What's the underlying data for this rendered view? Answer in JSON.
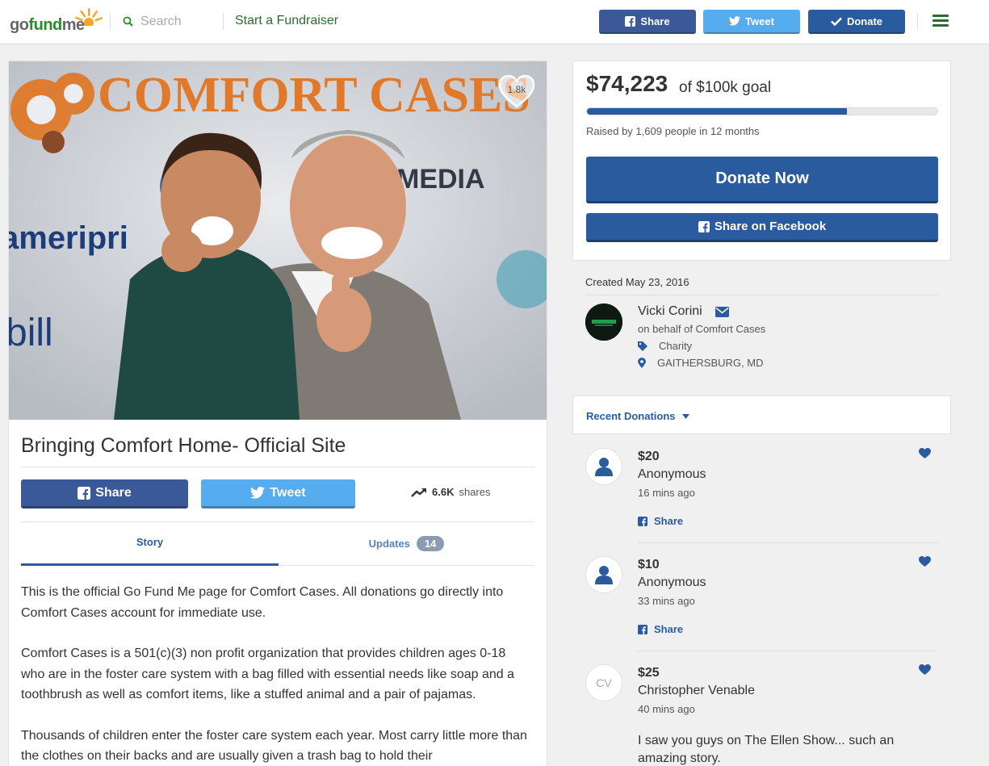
{
  "header": {
    "logo_parts": [
      "go",
      "fund",
      "me"
    ],
    "search_placeholder": "Search",
    "start_link": "Start a Fundraiser",
    "share_label": "Share",
    "tweet_label": "Tweet",
    "donate_label": "Donate"
  },
  "campaign": {
    "heart_count": "1.8k",
    "title": "Bringing Comfort Home- Official Site",
    "share_label": "Share",
    "tweet_label": "Tweet",
    "shares_count": "6.6K",
    "shares_word": "shares",
    "tabs": {
      "story": "Story",
      "updates": "Updates",
      "updates_count": "14"
    },
    "story_paragraphs": [
      "This is the official Go Fund Me page for Comfort Cases. All donations go directly into Comfort Cases account for immediate use.",
      "Comfort Cases is a 501(c)(3) non profit organization that provides children ages 0-18 who are in the foster care system with a bag filled with essential needs like soap and a toothbrush as well as comfort items, like a stuffed animal and a pair of pajamas.",
      "Thousands of children enter the foster care system each year. Most carry little more than the clothes on their backs and are usually given a trash bag to hold their"
    ],
    "photo_banner_words": [
      "COMFORT CASES",
      "MEDIA",
      "ameripri",
      "bill"
    ]
  },
  "funding": {
    "raised": "$74,223",
    "goal_text": "of $100k goal",
    "progress_fraction": 0.742,
    "raised_by": "Raised by 1,609 people in 12 months",
    "donate_now": "Donate Now",
    "share_facebook": "Share on Facebook"
  },
  "organizer": {
    "created": "Created May 23, 2016",
    "name": "Vicki Corini",
    "on_behalf": "on behalf of Comfort Cases",
    "category": "Charity",
    "location": "GAITHERSBURG, MD"
  },
  "recent": {
    "label": "Recent Donations",
    "donations": [
      {
        "amount": "$20",
        "name": "Anonymous",
        "time": "16 mins ago",
        "share": "Share"
      },
      {
        "amount": "$10",
        "name": "Anonymous",
        "time": "33 mins ago",
        "share": "Share"
      },
      {
        "amount": "$25",
        "name": "Christopher Venable",
        "initials": "CV",
        "time": "40 mins ago",
        "message": "I saw you guys on The Ellen Show... such an amazing story."
      }
    ]
  },
  "colors": {
    "brand_green": "#2d8a2d",
    "primary_blue": "#2a5b9e",
    "facebook_blue": "#3b5998",
    "twitter_blue": "#55acee"
  }
}
